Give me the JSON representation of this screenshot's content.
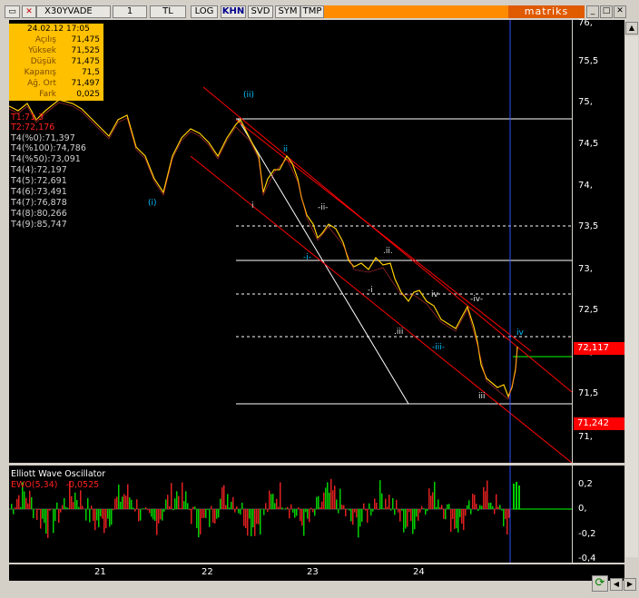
{
  "toolbar": {
    "symbol": "X30YVADE",
    "period": "1",
    "currency": "TL",
    "log": "LOG",
    "khn": "KHN",
    "svd": "SVD",
    "sym": "SYM",
    "tmp": "TMP",
    "brand": "matriks"
  },
  "info": {
    "date": "24.02.12 17:05",
    "rows": [
      {
        "label": "Açılış",
        "value": "71,475"
      },
      {
        "label": "Yüksek",
        "value": "71,525"
      },
      {
        "label": "Düşük",
        "value": "71,475"
      },
      {
        "label": "Kapanış",
        "value": "71,5"
      },
      {
        "label": "Ağ. Ort",
        "value": "71,497"
      },
      {
        "label": "Fark",
        "value": "0,025"
      }
    ]
  },
  "indicators": {
    "t1": "T1:71,3",
    "t2": "T2:72,176",
    "list": [
      "T4(%0):71,397",
      "T4(%100):74,786",
      "T4(%50):73,091",
      "T4(4):72,197",
      "T4(5):72,691",
      "T4(6):73,491",
      "T4(7):76,878",
      "T4(8):80,266",
      "T4(9):85,747"
    ]
  },
  "yaxis": [
    "76,",
    "75,5",
    "75,",
    "74,5",
    "74,",
    "73,5",
    "73,",
    "72,5",
    "72,",
    "71,5",
    "71,"
  ],
  "price_boxes": {
    "upper": "72,117",
    "lower": "71,242"
  },
  "waves": {
    "ii_top": "(ii)",
    "i_paren": "(i)",
    "i": "i",
    "ii": "ii",
    "mii": "-ii-",
    "mi": "-i-",
    "dii": ".ii.",
    "di": "-i",
    "iv": "iv",
    "miv": "-iv-",
    "iii": ".iii",
    "miii": "-iii-",
    "iii2": "iii",
    "iv2": "iv"
  },
  "oscillator": {
    "title": "Elliott Wave Oscillator",
    "series": "EWO(5,34)",
    "value": "-0,0525",
    "axis": [
      "0,2",
      "0,",
      "-0,2",
      "-0,4"
    ]
  },
  "xaxis": [
    "21",
    "22",
    "23",
    "24"
  ]
}
